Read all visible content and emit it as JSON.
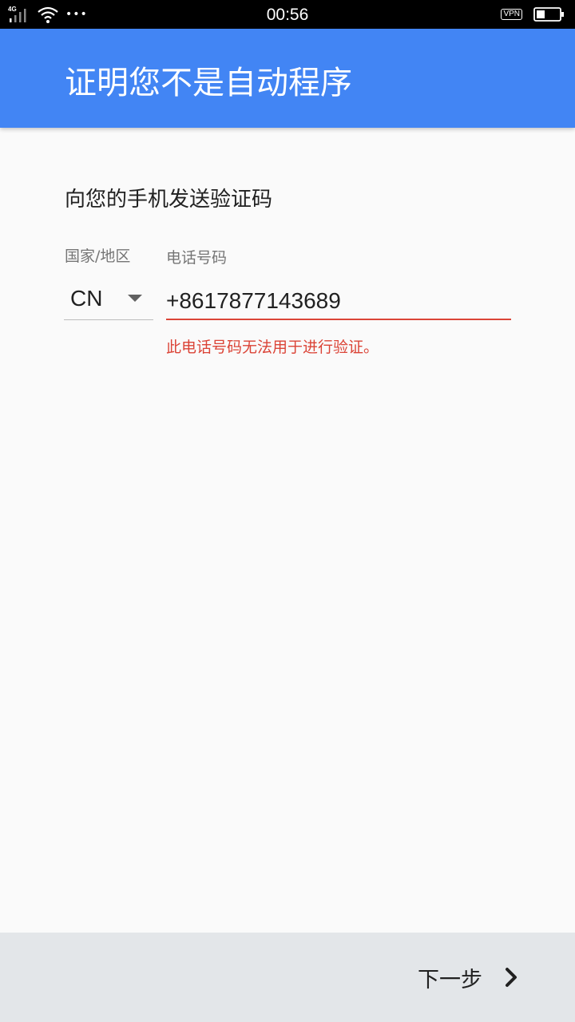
{
  "status_bar": {
    "network": "4G",
    "more": "•••",
    "time": "00:56",
    "vpn": "VPN",
    "icons": [
      "signal-icon",
      "wifi-icon",
      "battery-icon"
    ]
  },
  "app_bar": {
    "title": "证明您不是自动程序"
  },
  "form": {
    "prompt": "向您的手机发送验证码",
    "country_label": "国家/地区",
    "country_value": "CN",
    "phone_label": "电话号码",
    "phone_value": "+8617877143689",
    "error_message": "此电话号码无法用于进行验证。"
  },
  "bottom_bar": {
    "next_label": "下一步"
  },
  "colors": {
    "app_bar": "#4285f4",
    "background": "#fafafa",
    "error": "#db4437",
    "bottom_bar": "#e3e6e9"
  }
}
